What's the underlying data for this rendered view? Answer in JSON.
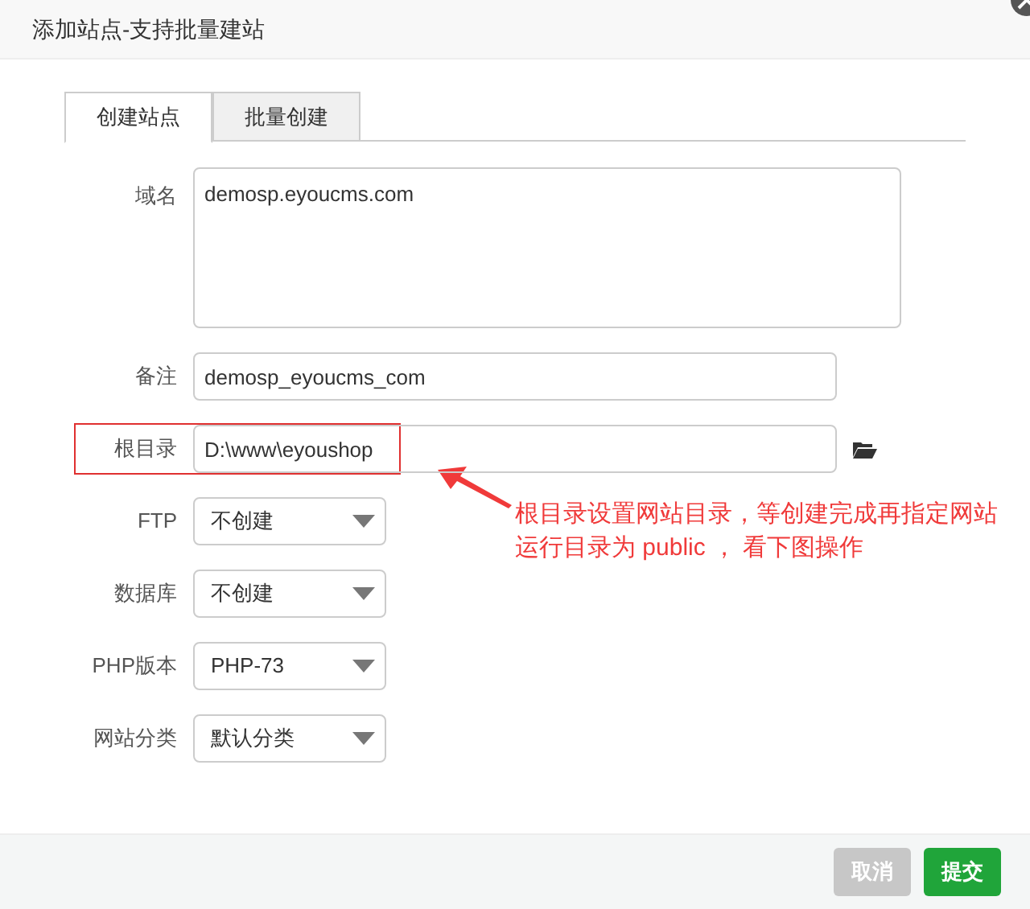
{
  "window": {
    "title": "添加站点-支持批量建站"
  },
  "tabs": [
    {
      "label": "创建站点",
      "selected": true
    },
    {
      "label": "批量创建",
      "selected": false
    }
  ],
  "fields": [
    {
      "kind": "textarea",
      "label": "域名",
      "value": "demosp.eyoucms.com"
    },
    {
      "kind": "input",
      "label": "备注",
      "value": "demosp_eyoucms_com"
    },
    {
      "kind": "folder",
      "label": "根目录",
      "value": "D:\\www\\eyoushop",
      "highlighted": true
    },
    {
      "kind": "select",
      "label": "FTP",
      "value": "不创建"
    },
    {
      "kind": "select",
      "label": "数据库",
      "value": "不创建"
    },
    {
      "kind": "select",
      "label": "PHP版本",
      "value": "PHP-73"
    },
    {
      "kind": "select",
      "label": "网站分类",
      "value": "默认分类"
    }
  ],
  "annotation": {
    "text": "根目录设置网站目录，等创建完成再指定网站运行目录为 public ， 看下图操作"
  },
  "buttons": [
    {
      "label": "取消",
      "kind": "cancel"
    },
    {
      "label": "提交",
      "kind": "primary"
    }
  ]
}
